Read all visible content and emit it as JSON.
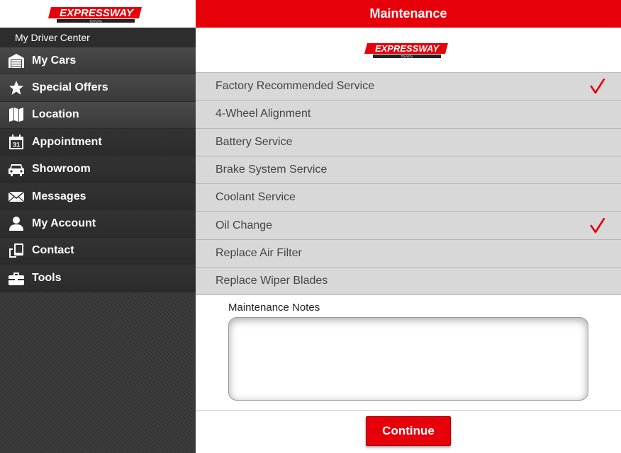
{
  "brand": {
    "logo_text": "EXPRESSWAY",
    "logo_subtext": "TOYOTA",
    "accent_color": "#e5000a"
  },
  "sidebar": {
    "subtitle": "My Driver Center",
    "items": [
      {
        "label": "My Cars",
        "icon": "garage-icon"
      },
      {
        "label": "Special Offers",
        "icon": "star-icon"
      },
      {
        "label": "Location",
        "icon": "map-icon"
      },
      {
        "label": "Appointment",
        "icon": "calendar-icon",
        "icon_text": "31"
      },
      {
        "label": "Showroom",
        "icon": "car-icon"
      },
      {
        "label": "Messages",
        "icon": "envelope-icon"
      },
      {
        "label": "My Account",
        "icon": "user-icon"
      },
      {
        "label": "Contact",
        "icon": "phone-icon"
      },
      {
        "label": "Tools",
        "icon": "toolbox-icon"
      }
    ]
  },
  "header": {
    "title": "Maintenance"
  },
  "services": [
    {
      "label": "Factory Recommended Service",
      "checked": true
    },
    {
      "label": "4-Wheel Alignment",
      "checked": false
    },
    {
      "label": "Battery Service",
      "checked": false
    },
    {
      "label": "Brake System Service",
      "checked": false
    },
    {
      "label": "Coolant Service",
      "checked": false
    },
    {
      "label": "Oil Change",
      "checked": true
    },
    {
      "label": "Replace Air Filter",
      "checked": false
    },
    {
      "label": "Replace Wiper Blades",
      "checked": false
    }
  ],
  "notes": {
    "label": "Maintenance Notes",
    "value": ""
  },
  "footer": {
    "continue_label": "Continue"
  }
}
